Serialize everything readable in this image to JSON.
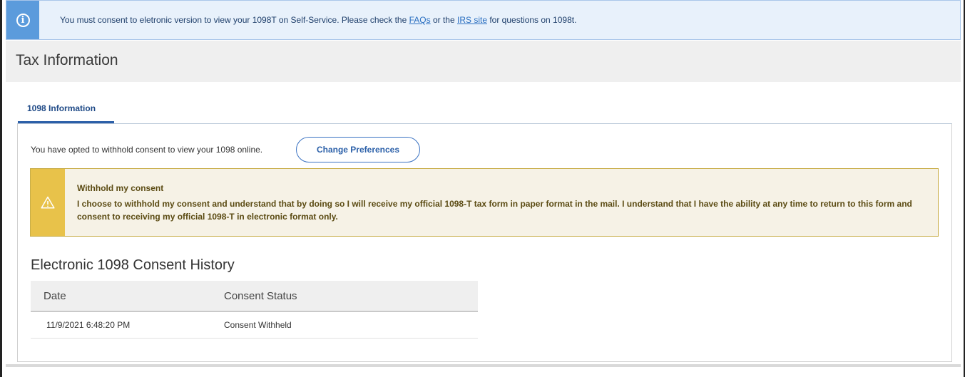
{
  "banner": {
    "icon": "info-icon",
    "text_before_faq": "You must consent to eletronic version to view your 1098T on Self-Service. Please check the ",
    "faq_link": "FAQs",
    "text_between": " or the ",
    "irs_link": "IRS site",
    "text_after": " for questions on 1098t."
  },
  "page": {
    "title": "Tax Information"
  },
  "tabs": [
    {
      "label": "1098 Information",
      "active": true
    }
  ],
  "consent": {
    "status_text": "You have opted to withhold consent to view your 1098 online.",
    "change_button": "Change Preferences"
  },
  "warning": {
    "icon": "warning-icon",
    "title": "Withhold my consent",
    "body": "I choose to withhold my consent and understand that by doing so I will receive my official 1098-T tax form in paper format in the mail. I understand that I have the ability at any time to return to this form and consent to receiving my official 1098-T in electronic format only."
  },
  "history": {
    "heading": "Electronic 1098 Consent History",
    "columns": [
      "Date",
      "Consent Status"
    ],
    "rows": [
      {
        "date": "11/9/2021 6:48:20 PM",
        "status": "Consent Withheld"
      }
    ]
  },
  "colors": {
    "accent": "#2b5fa8",
    "info_bg": "#e8f1fb",
    "warning_bar": "#e8c24a",
    "warning_bg": "#f6f2e6"
  }
}
